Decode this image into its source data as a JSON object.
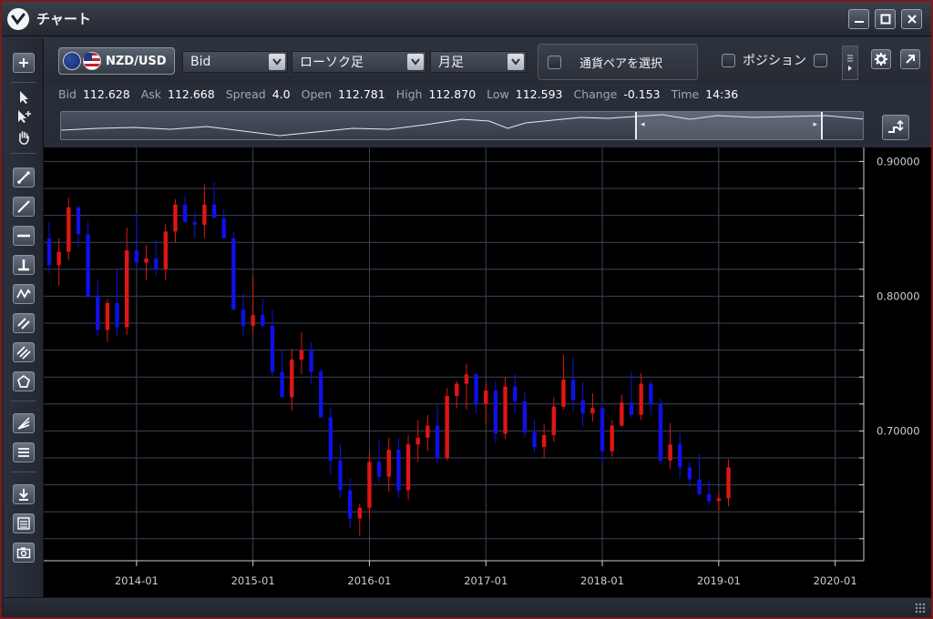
{
  "window": {
    "title": "チャート"
  },
  "toolbar": {
    "pair": "NZD/USD",
    "price_type": "Bid",
    "chart_type": "ローソク足",
    "timeframe": "月足",
    "select_pair_label": "通貨ペアを選択",
    "position_label": "ポジション",
    "position_checked": false
  },
  "quote": {
    "bid_label": "Bid",
    "bid": "112.628",
    "ask_label": "Ask",
    "ask": "112.668",
    "spread_label": "Spread",
    "spread": "4.0",
    "open_label": "Open",
    "open": "112.781",
    "high_label": "High",
    "high": "112.870",
    "low_label": "Low",
    "low": "112.593",
    "change_label": "Change",
    "change": "-0.153",
    "time_label": "Time",
    "time": "14:36"
  },
  "icons": {
    "app": "app-logo-icon",
    "tools": [
      "add-icon",
      "cursor-icon",
      "crosshair-cursor-icon",
      "hand-icon",
      "trend-line-icon",
      "line-icon",
      "horizontal-line-icon",
      "vertical-line-icon",
      "wave-icon",
      "channel-icon",
      "parallel-icon",
      "pentagon-icon",
      "fibonacci-icon",
      "bars-icon",
      "download-icon",
      "list-icon",
      "camera-icon"
    ]
  },
  "colors": {
    "up": "#e01515",
    "down": "#1010e8",
    "grid": "#3a4458",
    "axis_text": "#c9ced6",
    "background": "#000000"
  },
  "chart_data": {
    "type": "candlestick",
    "y_ticks": [
      "0.90000",
      "0.80000",
      "0.70000"
    ],
    "ylim": [
      0.605,
      0.905
    ],
    "x_ticks": [
      "2014-01",
      "2015-01",
      "2016-01",
      "2017-01",
      "2018-01",
      "2019-01",
      "2020-01"
    ],
    "start": "2013-04",
    "grid": true,
    "candles": [
      [
        0.843,
        0.855,
        0.817,
        0.823
      ],
      [
        0.823,
        0.843,
        0.808,
        0.833
      ],
      [
        0.833,
        0.873,
        0.827,
        0.866
      ],
      [
        0.866,
        0.867,
        0.836,
        0.846
      ],
      [
        0.846,
        0.855,
        0.798,
        0.8
      ],
      [
        0.8,
        0.812,
        0.77,
        0.775
      ],
      [
        0.775,
        0.798,
        0.766,
        0.795
      ],
      [
        0.795,
        0.82,
        0.77,
        0.777
      ],
      [
        0.777,
        0.851,
        0.771,
        0.834
      ],
      [
        0.834,
        0.862,
        0.82,
        0.825
      ],
      [
        0.825,
        0.838,
        0.812,
        0.828
      ],
      [
        0.828,
        0.842,
        0.815,
        0.82
      ],
      [
        0.82,
        0.854,
        0.812,
        0.848
      ],
      [
        0.848,
        0.872,
        0.84,
        0.868
      ],
      [
        0.868,
        0.875,
        0.855,
        0.855
      ],
      [
        0.855,
        0.862,
        0.843,
        0.853
      ],
      [
        0.853,
        0.883,
        0.843,
        0.868
      ],
      [
        0.868,
        0.885,
        0.858,
        0.858
      ],
      [
        0.858,
        0.864,
        0.845,
        0.843
      ],
      [
        0.843,
        0.848,
        0.79,
        0.79
      ],
      [
        0.79,
        0.802,
        0.771,
        0.778
      ],
      [
        0.778,
        0.815,
        0.772,
        0.786
      ],
      [
        0.786,
        0.798,
        0.776,
        0.778
      ],
      [
        0.778,
        0.79,
        0.741,
        0.744
      ],
      [
        0.744,
        0.76,
        0.725,
        0.725
      ],
      [
        0.725,
        0.761,
        0.715,
        0.753
      ],
      [
        0.753,
        0.773,
        0.742,
        0.76
      ],
      [
        0.76,
        0.766,
        0.735,
        0.744
      ],
      [
        0.744,
        0.746,
        0.71,
        0.71
      ],
      [
        0.71,
        0.718,
        0.668,
        0.678
      ],
      [
        0.678,
        0.69,
        0.65,
        0.656
      ],
      [
        0.656,
        0.665,
        0.628,
        0.635
      ],
      [
        0.635,
        0.646,
        0.622,
        0.643
      ],
      [
        0.643,
        0.684,
        0.636,
        0.677
      ],
      [
        0.677,
        0.693,
        0.662,
        0.666
      ],
      [
        0.666,
        0.695,
        0.655,
        0.686
      ],
      [
        0.686,
        0.695,
        0.65,
        0.656
      ],
      [
        0.656,
        0.697,
        0.649,
        0.69
      ],
      [
        0.69,
        0.708,
        0.677,
        0.695
      ],
      [
        0.695,
        0.712,
        0.685,
        0.704
      ],
      [
        0.704,
        0.719,
        0.676,
        0.68
      ],
      [
        0.68,
        0.732,
        0.678,
        0.726
      ],
      [
        0.726,
        0.737,
        0.717,
        0.735
      ],
      [
        0.735,
        0.75,
        0.716,
        0.742
      ],
      [
        0.742,
        0.743,
        0.713,
        0.72
      ],
      [
        0.72,
        0.735,
        0.705,
        0.73
      ],
      [
        0.73,
        0.737,
        0.691,
        0.698
      ],
      [
        0.698,
        0.74,
        0.694,
        0.733
      ],
      [
        0.733,
        0.742,
        0.713,
        0.722
      ],
      [
        0.722,
        0.729,
        0.695,
        0.699
      ],
      [
        0.699,
        0.708,
        0.684,
        0.688
      ],
      [
        0.688,
        0.705,
        0.68,
        0.697
      ],
      [
        0.697,
        0.725,
        0.692,
        0.718
      ],
      [
        0.718,
        0.757,
        0.716,
        0.738
      ],
      [
        0.738,
        0.754,
        0.715,
        0.723
      ],
      [
        0.723,
        0.736,
        0.703,
        0.713
      ],
      [
        0.713,
        0.728,
        0.707,
        0.717
      ],
      [
        0.717,
        0.721,
        0.676,
        0.685
      ],
      [
        0.685,
        0.708,
        0.681,
        0.704
      ],
      [
        0.704,
        0.727,
        0.703,
        0.721
      ],
      [
        0.721,
        0.744,
        0.71,
        0.712
      ],
      [
        0.712,
        0.743,
        0.708,
        0.735
      ],
      [
        0.735,
        0.737,
        0.712,
        0.72
      ],
      [
        0.72,
        0.724,
        0.675,
        0.678
      ],
      [
        0.678,
        0.706,
        0.672,
        0.69
      ],
      [
        0.69,
        0.698,
        0.665,
        0.673
      ],
      [
        0.673,
        0.677,
        0.659,
        0.664
      ],
      [
        0.664,
        0.683,
        0.652,
        0.653
      ],
      [
        0.653,
        0.663,
        0.645,
        0.648
      ],
      [
        0.648,
        0.655,
        0.641,
        0.65
      ],
      [
        0.65,
        0.679,
        0.644,
        0.673
      ]
    ]
  }
}
